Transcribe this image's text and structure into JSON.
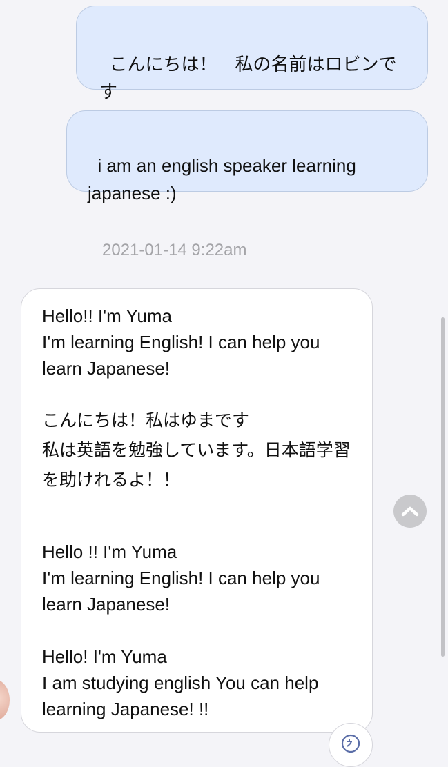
{
  "messages_out": [
    {
      "text": "こんにちは！　私の名前はロビンです"
    },
    {
      "text": "i am an english speaker learning japanese :)"
    }
  ],
  "timestamp": "2021-01-14 9:22am",
  "message_in": {
    "original_en": "Hello!! I'm Yuma\nI'm learning English! I can help you learn Japanese!",
    "original_jp": "こんにちは！私はゆまです\n私は英語を勉強しています。日本語学習を助けれるよ！！",
    "translation_1": "Hello !! I'm Yuma\nI'm learning English! I can help you learn Japanese!",
    "translation_2": "Hello! I'm Yuma\nI am studying english You can help learning Japanese! !!"
  },
  "icons": {
    "scroll_up": "chevron-up-icon",
    "translate": "translate-icon",
    "avatar": "avatar"
  },
  "colors": {
    "outgoing_bubble": "#dfeafd",
    "incoming_bubble": "#ffffff",
    "background": "#f4f4f8"
  }
}
